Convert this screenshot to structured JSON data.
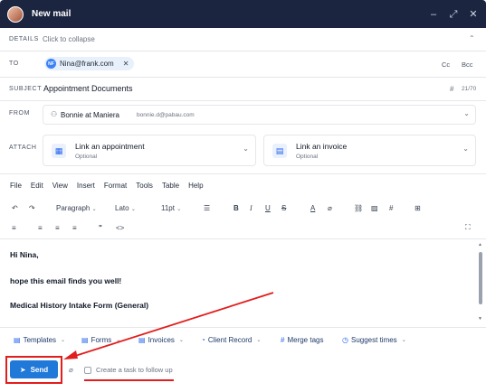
{
  "window": {
    "title": "New mail",
    "controls": [
      "–",
      "⤢",
      "✕"
    ]
  },
  "details": {
    "label": "DETAILS",
    "toggle": "Click to collapse"
  },
  "to": {
    "label": "TO",
    "chip_initials": "NF",
    "chip_email": "Nina@frank.com",
    "cc": "Cc",
    "bcc": "Bcc"
  },
  "subject": {
    "label": "SUBJECT",
    "value": "Appointment Documents",
    "counter": "21/70"
  },
  "from": {
    "label": "FROM",
    "name": "Bonnie at Maniera",
    "email": "bonnie.d@pabau.com"
  },
  "attach": {
    "label": "ATTACH",
    "appointment": {
      "title": "Link an appointment",
      "sub": "Optional"
    },
    "invoice": {
      "title": "Link an invoice",
      "sub": "Optional"
    }
  },
  "menubar": [
    "File",
    "Edit",
    "View",
    "Insert",
    "Format",
    "Tools",
    "Table",
    "Help"
  ],
  "toolbar": {
    "block": "Paragraph",
    "font": "Lato",
    "size": "11pt"
  },
  "editor": {
    "line1": "Hi Nina,",
    "line2": "hope this email finds you well!",
    "line3": "Medical History Intake Form (General)"
  },
  "actions": {
    "templates": "Templates",
    "forms": "Forms",
    "invoices": "Invoices",
    "client_record": "Client Record",
    "merge_tags": "Merge tags",
    "suggest_times": "Suggest times"
  },
  "footer": {
    "send": "Send",
    "task": "Create a task to follow up"
  },
  "colors": {
    "titlebar": "#1b2540",
    "accent": "#2078d8",
    "annotation": "#e21d1d"
  }
}
